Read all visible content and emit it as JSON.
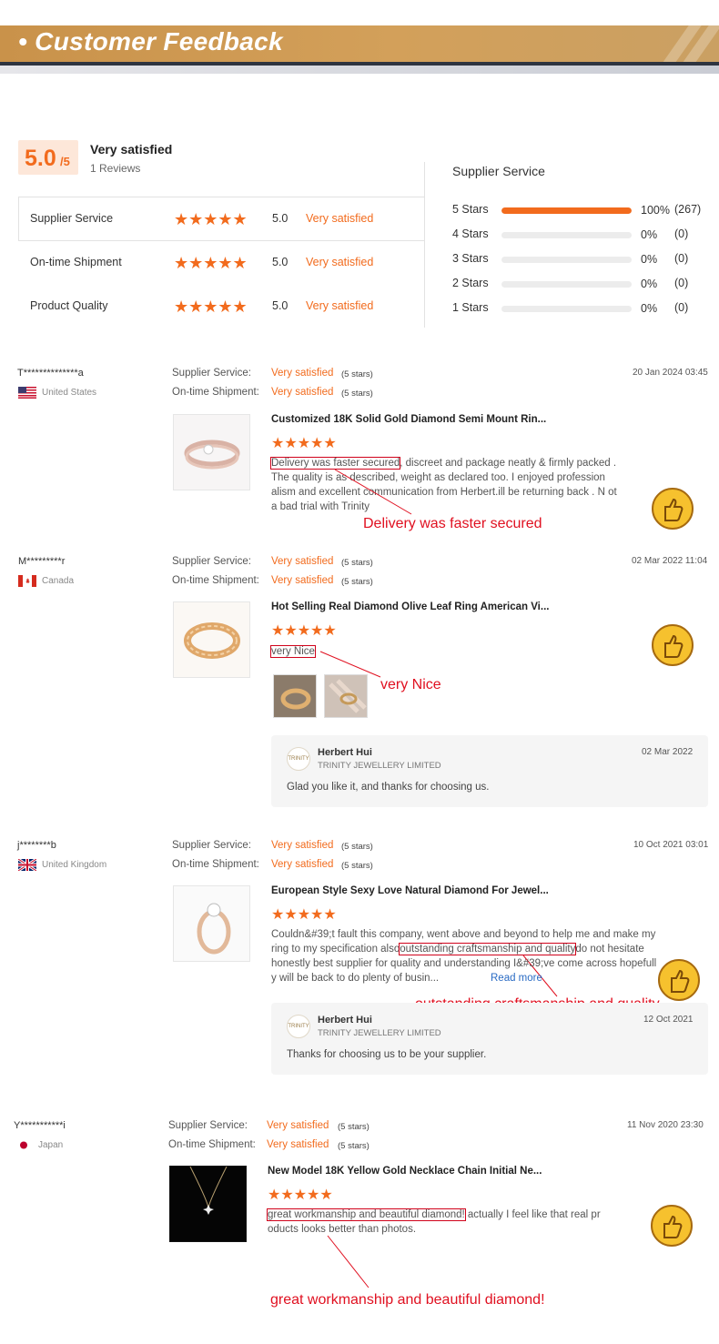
{
  "banner": {
    "title": "• Customer Feedback"
  },
  "summary": {
    "score": "5.0",
    "score_out_of": "/5",
    "label": "Very satisfied",
    "reviews": "1 Reviews",
    "categories": [
      {
        "label": "Supplier Service",
        "stars": "★★★★★",
        "score": "5.0",
        "text": "Very satisfied",
        "rating": 5
      },
      {
        "label": "On-time Shipment",
        "stars": "★★★★★",
        "score": "5.0",
        "text": "Very satisfied",
        "rating": 5
      },
      {
        "label": "Product Quality",
        "stars": "★★★★★",
        "score": "5.0",
        "text": "Very satisfied",
        "rating": 5
      }
    ],
    "distribution_title": "Supplier Service",
    "distribution": [
      {
        "label": "5  Stars",
        "fraction": 1.0,
        "pct": "100%",
        "count": "(267)"
      },
      {
        "label": "4  Stars",
        "fraction": 0,
        "pct": "0%",
        "count": "(0)"
      },
      {
        "label": "3  Stars",
        "fraction": 0,
        "pct": "0%",
        "count": "(0)"
      },
      {
        "label": "2  Stars",
        "fraction": 0,
        "pct": "0%",
        "count": "(0)"
      },
      {
        "label": "1  Stars",
        "fraction": 0,
        "pct": "0%",
        "count": "(0)"
      }
    ]
  },
  "reviews": [
    {
      "name": "T**************a",
      "country": "United States",
      "supplier_label": "Supplier Service:",
      "supplier_value": "Very satisfied",
      "supplier_stars": "(5 stars)",
      "shipment_label": "On-time Shipment:",
      "shipment_value": "Very satisfied",
      "shipment_stars": "(5 stars)",
      "date": "20 Jan 2024 03:45",
      "product": "Customized 18K Solid Gold Diamond Semi Mount Rin...",
      "stars": "★★★★★",
      "highlight": "Delivery was faster secured",
      "text_rest": ", discreet and package neatly & firmly packed . The quality is as described, weight as declared too. I enjoyed profession alism and excellent communication from Herbert.ill be returning back . N ot a bad trial with Trinity",
      "annotation": "Delivery was faster secured"
    },
    {
      "name": "M*********r",
      "country": "Canada",
      "supplier_label": "Supplier Service:",
      "supplier_value": "Very satisfied",
      "supplier_stars": "(5 stars)",
      "shipment_label": "On-time Shipment:",
      "shipment_value": "Very satisfied",
      "shipment_stars": "(5 stars)",
      "date": "02 Mar 2022 11:04",
      "product": "Hot Selling Real Diamond Olive Leaf Ring American Vi...",
      "stars": "★★★★★",
      "highlight": "very Nice",
      "annotation": "very Nice",
      "reply": {
        "name": "Herbert Hui",
        "company": "TRINITY JEWELLERY LIMITED",
        "date": "02 Mar 2022",
        "text": "Glad you like it, and thanks for choosing us."
      }
    },
    {
      "name": "j********b",
      "country": "United Kingdom",
      "supplier_label": "Supplier Service:",
      "supplier_value": "Very satisfied",
      "supplier_stars": "(5 stars)",
      "shipment_label": "On-time Shipment:",
      "shipment_value": "Very satisfied",
      "shipment_stars": "(5 stars)",
      "date": "10 Oct 2021 03:01",
      "product": "European Style Sexy Love Natural Diamond For Jewel...",
      "stars": "★★★★★",
      "text_line1": "Couldn&#39;t fault this company, went above and beyond to help me and make my",
      "text_line2_pre": "ring to my specification also",
      "highlight": "outstanding craftsmanship and quality",
      "text_line2_post": "do not hesitate",
      "text_line3": "honestly best supplier for quality and understanding I&#39;ve come across hopefull",
      "text_line4": "y will be back to do plenty of busin...",
      "read_more": "Read more",
      "annotation": "outstanding craftsmanship and quality",
      "reply": {
        "name": "Herbert Hui",
        "company": "TRINITY JEWELLERY LIMITED",
        "date": "12 Oct 2021",
        "text": "Thanks for choosing us to be your supplier."
      }
    },
    {
      "name": "Y***********i",
      "country": "Japan",
      "supplier_label": "Supplier Service:",
      "supplier_value": "Very satisfied",
      "supplier_stars": "(5 stars)",
      "shipment_label": "On-time Shipment:",
      "shipment_value": "Very satisfied",
      "shipment_stars": "(5 stars)",
      "date": "11 Nov 2020 23:30",
      "product": "New Model 18K Yellow Gold Necklace Chain Initial Ne...",
      "stars": "★★★★★",
      "highlight": "great workmanship and beautiful diamond!",
      "text_rest_line1": " actually I feel like that real pr",
      "text_line2": "oducts looks better than photos.",
      "annotation": "great workmanship and beautiful diamond!"
    }
  ],
  "colors": {
    "accent": "#f26b1d",
    "annotation": "#e01020",
    "banner": "#c9924a"
  },
  "logo_text": "TRINITY"
}
